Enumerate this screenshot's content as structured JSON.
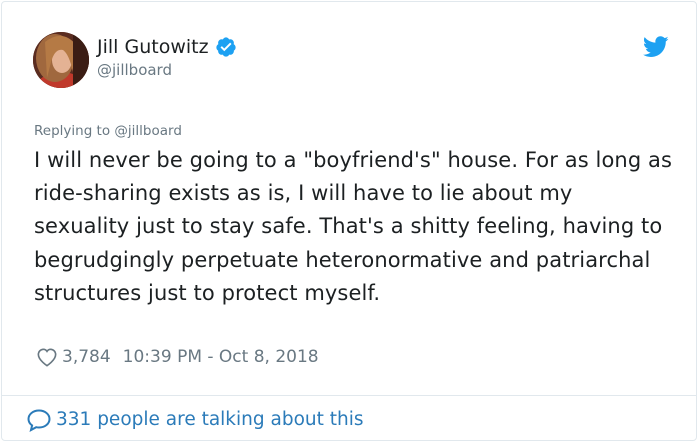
{
  "tweet": {
    "author": {
      "display_name": "Jill Gutowitz",
      "handle": "@jillboard",
      "verified": true
    },
    "replying_to": "Replying to @jillboard",
    "text": "I will never be going to a \"boyfriend's\" house. For as long as ride-sharing exists as is, I will have to lie about my sexuality just to stay safe. That's a shitty feeling, having to begrudgingly perpetuate heteronormative and patriarchal structures just to protect myself.",
    "likes": "3,784",
    "timestamp": "10:39 PM - Oct 8, 2018",
    "conversation": "331 people are talking about this"
  },
  "icons": {
    "verified": "verified-badge-icon",
    "twitter": "twitter-bird-icon",
    "like": "heart-icon",
    "conversation": "speech-bubble-icon"
  },
  "colors": {
    "twitter_blue": "#1da1f2",
    "link_blue": "#2b7bb9",
    "text": "#1c2022",
    "secondary_text": "#697882",
    "border": "#e1e8ed"
  }
}
